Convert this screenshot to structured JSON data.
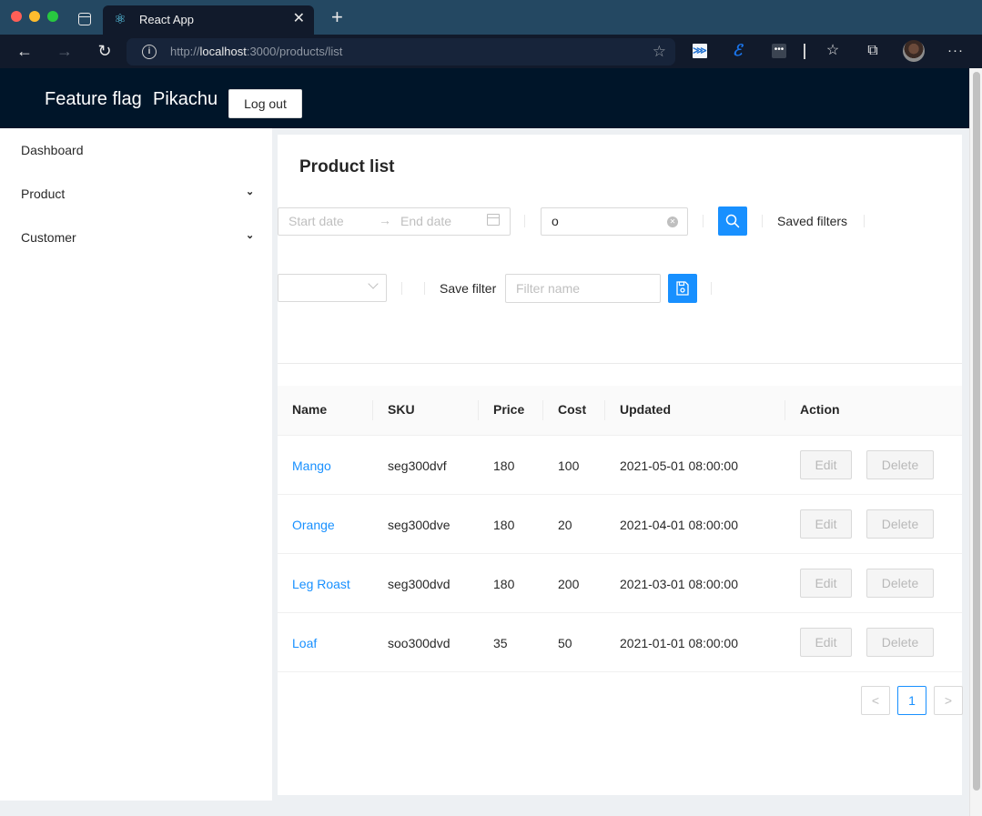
{
  "browser": {
    "tab_title": "React App",
    "url_prefix": "http://",
    "url_host": "localhost",
    "url_rest": ":3000/products/list",
    "icons": [
      "react-favicon",
      "back-arrow",
      "forward-arrow",
      "reload",
      "info",
      "add-favorite",
      "extension-1",
      "extension-2",
      "extension-3",
      "favorites",
      "collections",
      "profile-avatar",
      "more"
    ]
  },
  "header": {
    "brand": "Feature flag",
    "user": "Pikachu",
    "logout_label": "Log out"
  },
  "sidebar": {
    "items": [
      {
        "label": "Dashboard",
        "expandable": false
      },
      {
        "label": "Product",
        "expandable": true
      },
      {
        "label": "Customer",
        "expandable": true
      }
    ]
  },
  "main": {
    "title": "Product list",
    "filters": {
      "start_date_placeholder": "Start date",
      "end_date_placeholder": "End date",
      "range_separator": "→",
      "search_value": "o",
      "saved_filters_label": "Saved filters",
      "saved_filter_select_value": "",
      "save_filter_label": "Save filter",
      "filter_name_placeholder": "Filter name",
      "filter_name_value": ""
    },
    "table": {
      "columns": [
        "Name",
        "SKU",
        "Price",
        "Cost",
        "Updated",
        "Action"
      ],
      "rows": [
        {
          "name": "Mango",
          "sku": "seg300dvf",
          "price": "180",
          "cost": "100",
          "updated": "2021-05-01 08:00:00"
        },
        {
          "name": "Orange",
          "sku": "seg300dve",
          "price": "180",
          "cost": "20",
          "updated": "2021-04-01 08:00:00"
        },
        {
          "name": "Leg Roast",
          "sku": "seg300dvd",
          "price": "180",
          "cost": "200",
          "updated": "2021-03-01 08:00:00"
        },
        {
          "name": "Loaf",
          "sku": "soo300dvd",
          "price": "35",
          "cost": "50",
          "updated": "2021-01-01 08:00:00"
        }
      ],
      "edit_label": "Edit",
      "delete_label": "Delete",
      "actions_disabled": true
    },
    "pagination": {
      "prev": "<",
      "current_page": "1",
      "next": ">"
    }
  },
  "colors": {
    "primary": "#1890ff",
    "header_bg": "#001529",
    "browser_bg": "#111a2b"
  }
}
